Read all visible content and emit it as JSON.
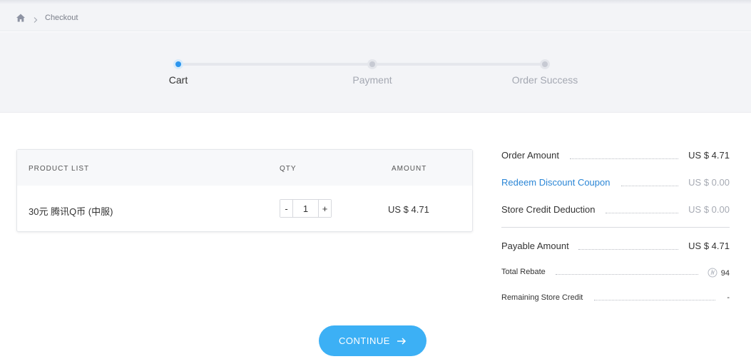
{
  "breadcrumb": {
    "current": "Checkout"
  },
  "steps": [
    {
      "label": "Cart",
      "active": true
    },
    {
      "label": "Payment",
      "active": false
    },
    {
      "label": "Order Success",
      "active": false
    }
  ],
  "cart": {
    "columns": {
      "product": "PRODUCT LIST",
      "qty": "QTY",
      "amount": "AMOUNT"
    },
    "item": {
      "name": "30元 腾讯Q币 (中服)",
      "qty": "1",
      "amount": "US $ 4.71"
    },
    "minus_label": "-",
    "plus_label": "+"
  },
  "summary": {
    "order_amount_label": "Order Amount",
    "order_amount": "US $ 4.71",
    "coupon_label": "Redeem Discount Coupon",
    "coupon_value": "US $ 0.00",
    "store_credit_label": "Store Credit Deduction",
    "store_credit_value": "US $ 0.00",
    "payable_label": "Payable Amount",
    "payable_value": "US $ 4.71",
    "rebate_label": "Total Rebate",
    "rebate_value": "94",
    "remaining_label": "Remaining Store Credit",
    "remaining_value": "-"
  },
  "continue_label": "CONTINUE",
  "colors": {
    "accent": "#3cb0f5",
    "active_step": "#2b95ee",
    "link": "#2b86d6"
  },
  "icons": {
    "home": "home-icon",
    "separator": "chevron-right-icon",
    "rebate": "rebate-coin-icon",
    "continue": "arrow-right-icon"
  }
}
